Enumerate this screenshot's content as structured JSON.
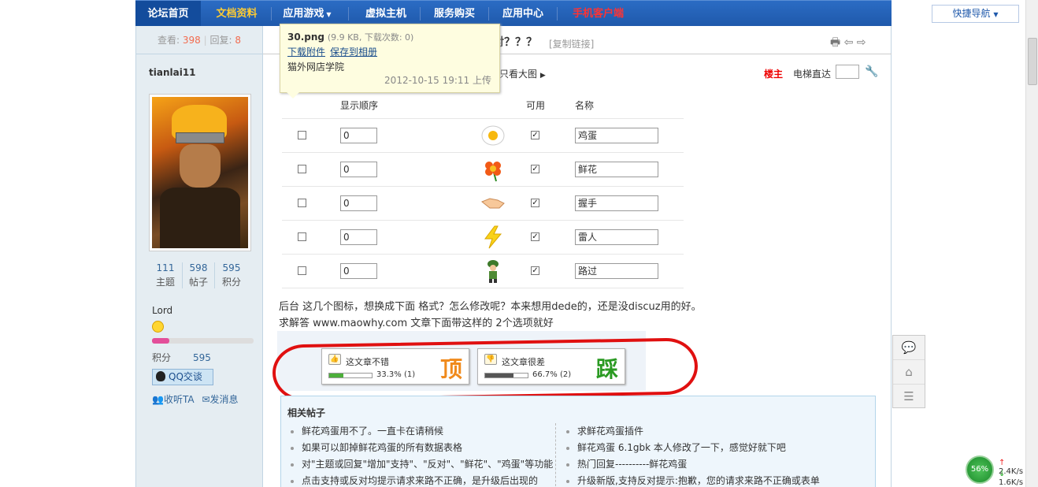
{
  "nav": {
    "items": [
      "论坛首页",
      "文档资料",
      "应用游戏",
      "虚拟主机",
      "服务购买",
      "应用中心",
      "手机客户端"
    ],
    "quick_nav": "快捷导航"
  },
  "colors": {
    "nav_bg": "#1f59ab",
    "doc_link": "#ffcc33",
    "mobile_link": "#ff3333",
    "ring": "#e01010",
    "ding": "#f08a1c",
    "cai": "#2a9a22"
  },
  "stats": {
    "views_label": "查看:",
    "views": "398",
    "replies_label": "回复:",
    "replies": "8"
  },
  "user": {
    "name": "tianlai11",
    "topics": "111",
    "topics_label": "主题",
    "posts": "598",
    "posts_label": "帖子",
    "credits": "595",
    "credits_label": "积分",
    "rank": "Lord",
    "points_label": "积分",
    "points": "595",
    "level_progress": 0.17,
    "qq_label": "QQ交谈",
    "listen_label": "收听TA",
    "message_label": "发消息"
  },
  "thread": {
    "title_tail": "对？？？",
    "copy_link": "[复制链接]",
    "only_big": "只看大图",
    "louzhu": "楼主",
    "elevator": "电梯直达"
  },
  "tooltip": {
    "filename": "30.png",
    "meta": "(9.9 KB, 下载次数: 0)",
    "download": "下载附件",
    "save_album": "保存到相册",
    "source": "猫外网店学院",
    "date": "2012-10-15 19:11 上传"
  },
  "table": {
    "col_order": "显示顺序",
    "col_enabled": "可用",
    "col_name": "名称",
    "rows": [
      {
        "order": "0",
        "name": "鸡蛋",
        "icon": "egg-icon"
      },
      {
        "order": "0",
        "name": "鲜花",
        "icon": "flower-icon"
      },
      {
        "order": "0",
        "name": "握手",
        "icon": "handshake-icon"
      },
      {
        "order": "0",
        "name": "雷人",
        "icon": "lightning-icon"
      },
      {
        "order": "0",
        "name": "路过",
        "icon": "soldier-icon"
      }
    ]
  },
  "body": {
    "line1": "后台 这几个图标，想换成下面 格式？怎么修改呢？本来想用dede的，还是没discuz用的好。",
    "line2": "求解答  www.maowhy.com  文章下面带这样的 2个选项就好"
  },
  "vote": {
    "up_label": "这文章不错",
    "up_pct": "33.3% (1)",
    "up_fill": 0.333,
    "up_big": "顶",
    "down_label": "这文章很差",
    "down_pct": "66.7% (2)",
    "down_fill": 0.667,
    "down_big": "踩"
  },
  "related": {
    "title": "相关帖子",
    "left": [
      "鲜花鸡蛋用不了。一直卡在请稍候",
      "如果可以卸掉鲜花鸡蛋的所有数据表格",
      "对\"主题或回复\"增加\"支持\"、\"反对\"、\"鲜花\"、\"鸡蛋\"等功能",
      "点击支持或反对均提示请求来路不正确，是升级后出现的"
    ],
    "right": [
      "求鲜花鸡蛋插件",
      "鲜花鸡蛋 6.1gbk 本人修改了一下，感觉好就下吧",
      "热门回复----------鲜花鸡蛋",
      "升级新版,支持反对提示:抱歉，您的请求来路不正确或表单"
    ]
  },
  "netmon": {
    "percent": "56%",
    "up": "2.4K/s",
    "down": "1.6K/s"
  }
}
